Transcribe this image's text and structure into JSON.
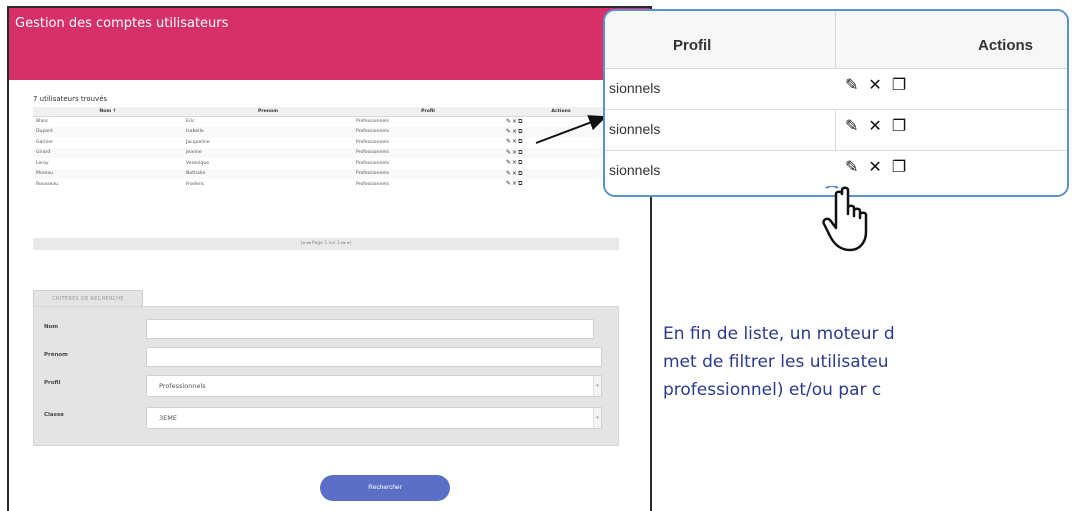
{
  "app": {
    "title": "Gestion des comptes utilisateurs",
    "brand_color": "#d6306a"
  },
  "results": {
    "count_text": "7 utilisateurs trouvés",
    "columns": [
      "Nom ↑",
      "Prenom",
      "Profil",
      "Actions"
    ],
    "rows": [
      {
        "nom": "Blanc",
        "prenom": "Eric",
        "profil": "Professionnels"
      },
      {
        "nom": "Dupont",
        "prenom": "Isabelle",
        "profil": "Professionnels"
      },
      {
        "nom": "Garnier",
        "prenom": "Jacqueline",
        "profil": "Professionnels"
      },
      {
        "nom": "Girard",
        "prenom": "Jeanne",
        "profil": "Professionnels"
      },
      {
        "nom": "Leroy",
        "prenom": "Veronique",
        "profil": "Professionnels"
      },
      {
        "nom": "Moreau",
        "prenom": "Nathalie",
        "profil": "Professionnels"
      },
      {
        "nom": "Rousseau",
        "prenom": "Frederic",
        "profil": "Professionnels"
      }
    ],
    "pager_text": "|◂ ◂◂ Page 1 sur 1 ▸▸ ▸|"
  },
  "criteria": {
    "tab_label": "CRITERES DE RECHERCHE",
    "nom_label": "Nom",
    "prenom_label": "Prénom",
    "profil_label": "Profil",
    "profil_value": "Professionnels",
    "classe_label": "Classe",
    "classe_value": "3EME",
    "search_button": "Rechercher"
  },
  "zoom": {
    "profil_header": "Profil",
    "actions_header": "Actions",
    "rows": [
      "sionnels",
      "sionnels",
      "sionnels"
    ],
    "border_color": "#5b8fd0"
  },
  "icons": {
    "edit": "pencil-icon",
    "delete": "close-icon",
    "impersonate": "user-switch-icon",
    "pointer": "hand-pointer-icon"
  },
  "caption": {
    "line1": "En fin de liste, un moteur d",
    "line2": "met de filtrer les utilisateu",
    "line3": "professionnel) et/ou par c",
    "color": "#2b3a8f"
  }
}
